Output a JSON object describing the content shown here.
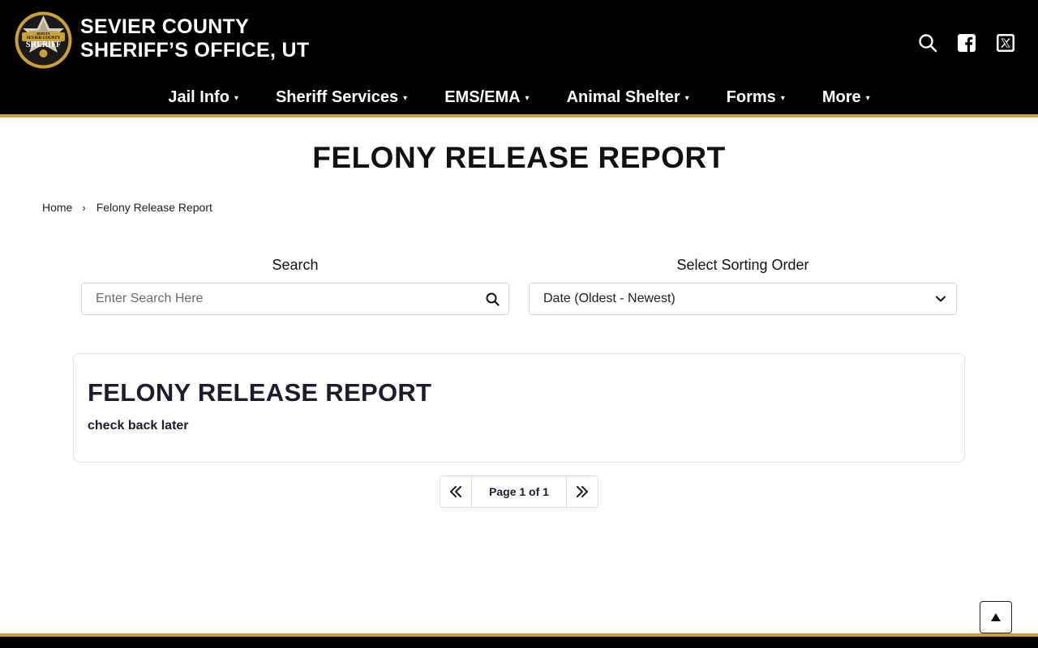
{
  "header": {
    "title_line1": "SEVIER COUNTY",
    "title_line2": "SHERIFF’S OFFICE, UT",
    "badge_text_top": "DEPUTY",
    "badge_text_mid": "SEVIER COUNTY",
    "badge_text_bottom": "SHERIFF",
    "icons": [
      "search-icon",
      "facebook-icon",
      "x-twitter-icon"
    ]
  },
  "nav": {
    "items": [
      {
        "label": "Jail Info"
      },
      {
        "label": "Sheriff Services"
      },
      {
        "label": "EMS/EMA"
      },
      {
        "label": "Animal Shelter"
      },
      {
        "label": "Forms"
      },
      {
        "label": "More"
      }
    ],
    "caret": "▾"
  },
  "page": {
    "title": "FELONY RELEASE REPORT"
  },
  "breadcrumb": {
    "home": "Home",
    "separator": "›",
    "current": "Felony Release Report"
  },
  "search": {
    "label": "Search",
    "placeholder": "Enter Search Here"
  },
  "sort": {
    "label": "Select Sorting Order",
    "selected": "Date (Oldest - Newest)"
  },
  "card": {
    "title": "FELONY RELEASE REPORT",
    "text": "check back later"
  },
  "pagination": {
    "info": "Page 1 of 1"
  },
  "colors": {
    "header_bg": "#000000",
    "accent_gold": "#c9a13b",
    "text_dark": "#1c1c2a"
  }
}
